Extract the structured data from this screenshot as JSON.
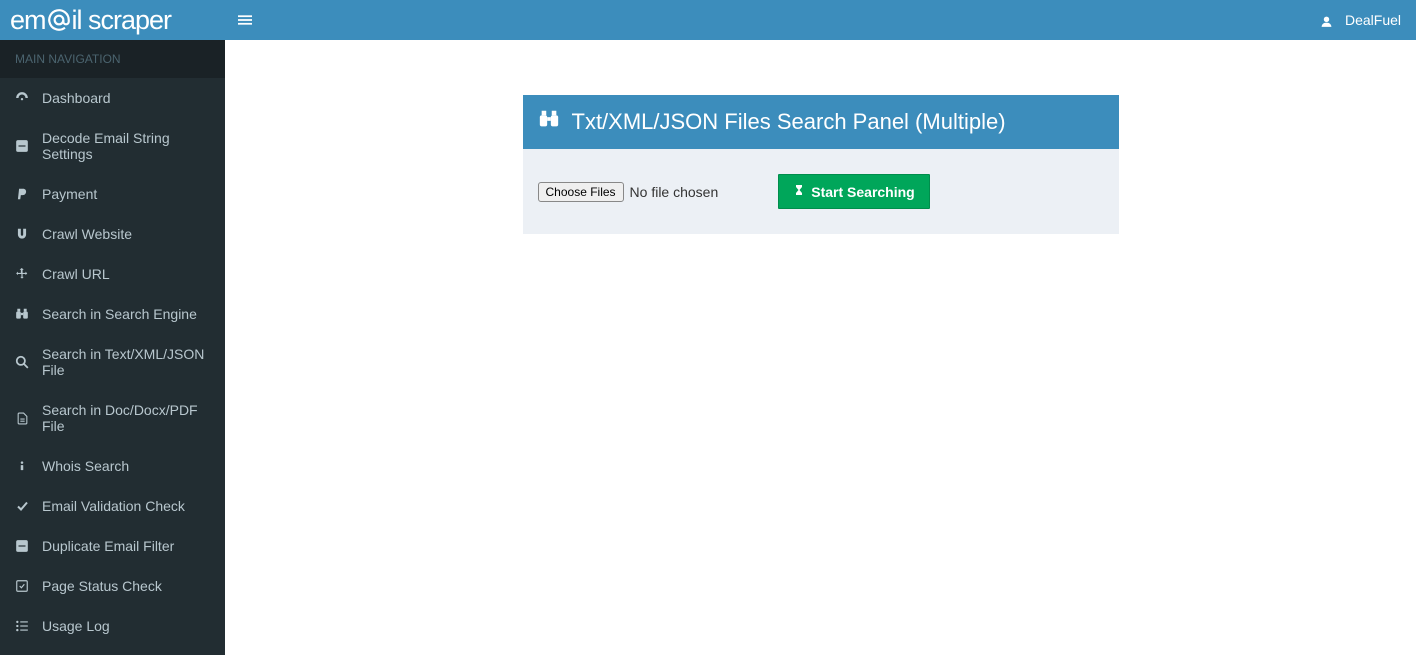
{
  "logo": {
    "pre": "em",
    "post": "il scraper"
  },
  "header": {
    "username": "DealFuel"
  },
  "sidebar": {
    "heading": "MAIN NAVIGATION",
    "items": [
      {
        "label": "Dashboard"
      },
      {
        "label": "Decode Email String Settings"
      },
      {
        "label": "Payment"
      },
      {
        "label": "Crawl Website"
      },
      {
        "label": "Crawl URL"
      },
      {
        "label": "Search in Search Engine"
      },
      {
        "label": "Search in Text/XML/JSON File"
      },
      {
        "label": "Search in Doc/Docx/PDF File"
      },
      {
        "label": "Whois Search"
      },
      {
        "label": "Email Validation Check"
      },
      {
        "label": "Duplicate Email Filter"
      },
      {
        "label": "Page Status Check"
      },
      {
        "label": "Usage Log"
      }
    ]
  },
  "panel": {
    "title": "Txt/XML/JSON Files Search Panel (Multiple)",
    "choose_files": "Choose Files",
    "no_file": "No file chosen",
    "start_btn": "Start Searching"
  }
}
